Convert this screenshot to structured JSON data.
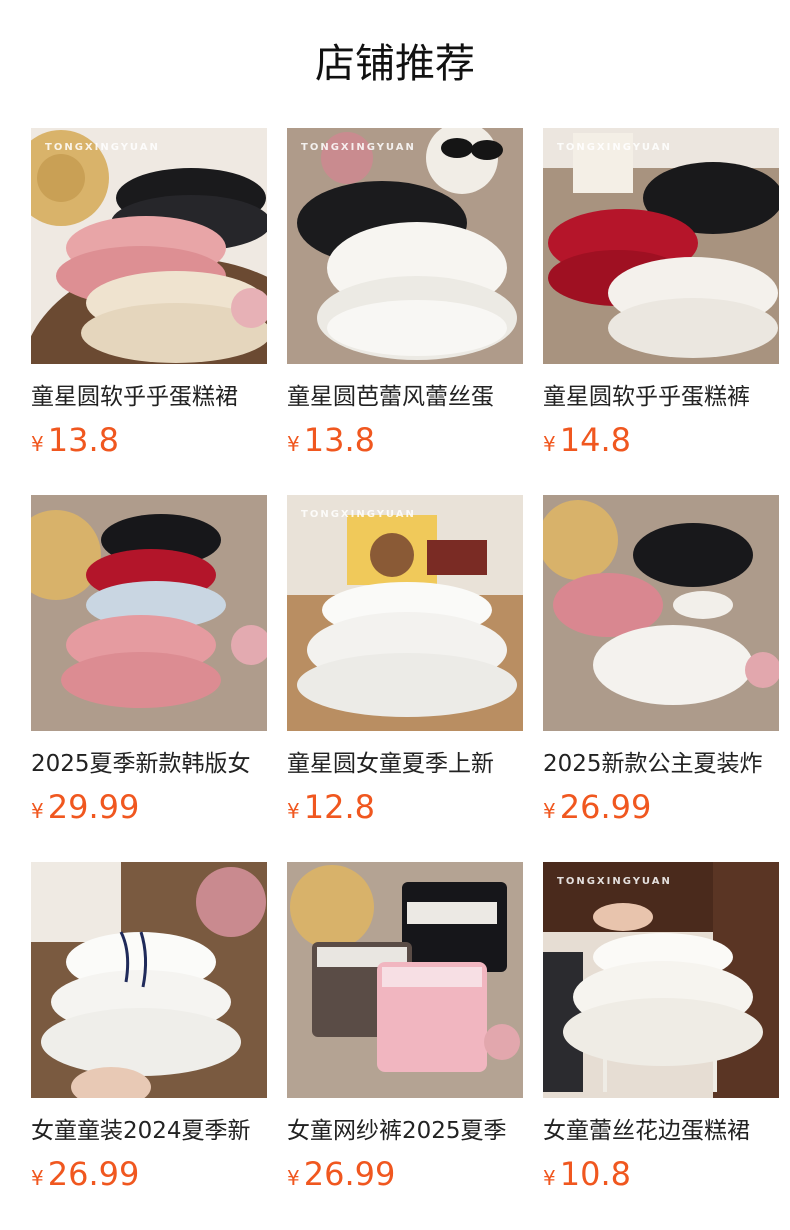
{
  "section": {
    "title": "店铺推荐"
  },
  "watermark": "TONGXINGYUAN",
  "colors": {
    "price": "#f0571f",
    "text": "#222222",
    "background": "#ffffff"
  },
  "products": [
    {
      "name": "童星圆软乎乎蛋糕裙",
      "currency": "¥",
      "price": "13.8",
      "image": "stacked-cake-skirts-black-pink-beige"
    },
    {
      "name": "童星圆芭蕾风蕾丝蛋",
      "currency": "¥",
      "price": "13.8",
      "image": "black-and-white-lace-skirts"
    },
    {
      "name": "童星圆软乎乎蛋糕裤",
      "currency": "¥",
      "price": "14.8",
      "image": "black-red-white-cake-pants"
    },
    {
      "name": "2025夏季新款韩版女",
      "currency": "¥",
      "price": "29.99",
      "image": "bow-skirts-black-red-blue-pink"
    },
    {
      "name": "童星圆女童夏季上新",
      "currency": "¥",
      "price": "12.8",
      "image": "white-lace-tutu-skirt"
    },
    {
      "name": "2025新款公主夏装炸",
      "currency": "¥",
      "price": "26.99",
      "image": "pleated-skirts-black-pink-white"
    },
    {
      "name": "女童童装2024夏季新",
      "currency": "¥",
      "price": "26.99",
      "image": "white-tiered-skirt-ribbon"
    },
    {
      "name": "女童网纱裤2025夏季",
      "currency": "¥",
      "price": "26.99",
      "image": "mesh-shorts-black-grey-pink"
    },
    {
      "name": "女童蕾丝花边蛋糕裙",
      "currency": "¥",
      "price": "10.8",
      "image": "white-lace-cake-skirt-on-chair"
    }
  ]
}
